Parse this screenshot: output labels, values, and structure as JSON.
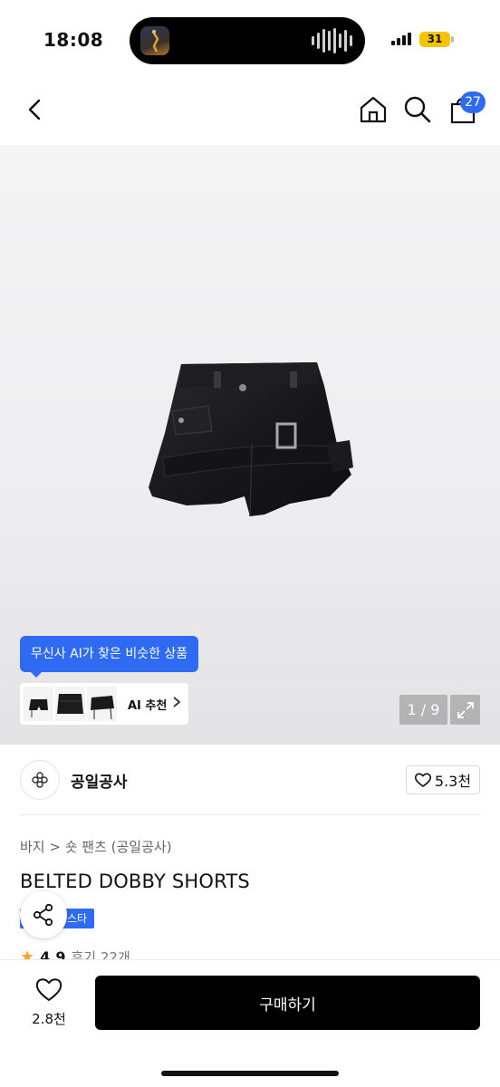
{
  "status_bar": {
    "time": "18:08",
    "battery": "31"
  },
  "header": {
    "back_icon": "chevron-left-icon",
    "home_icon": "home-icon",
    "search_icon": "search-icon",
    "cart_icon": "shopping-bag-icon",
    "cart_count": "27"
  },
  "gallery": {
    "ai_tooltip": "무신사 AI가 찾은 비슷한 상품",
    "ai_recommend_label": "AI 추천",
    "page_indicator": "1 / 9",
    "expand_icon": "expand-icon"
  },
  "brand": {
    "name": "공일공사",
    "likes": "5.3천"
  },
  "product": {
    "breadcrumb": "바지 > 숏 팬츠 (공일공사)",
    "title": "BELTED DOBBY SHORTS",
    "badge": "스타",
    "rating": "4.9",
    "reviews": "후기 22개"
  },
  "bottom_bar": {
    "wish_count": "2.8천",
    "buy_label": "구매하기"
  },
  "colors": {
    "accent": "#2f6bf2",
    "buy_button": "#000000",
    "battery": "#f5c400",
    "star": "#f5a623"
  }
}
